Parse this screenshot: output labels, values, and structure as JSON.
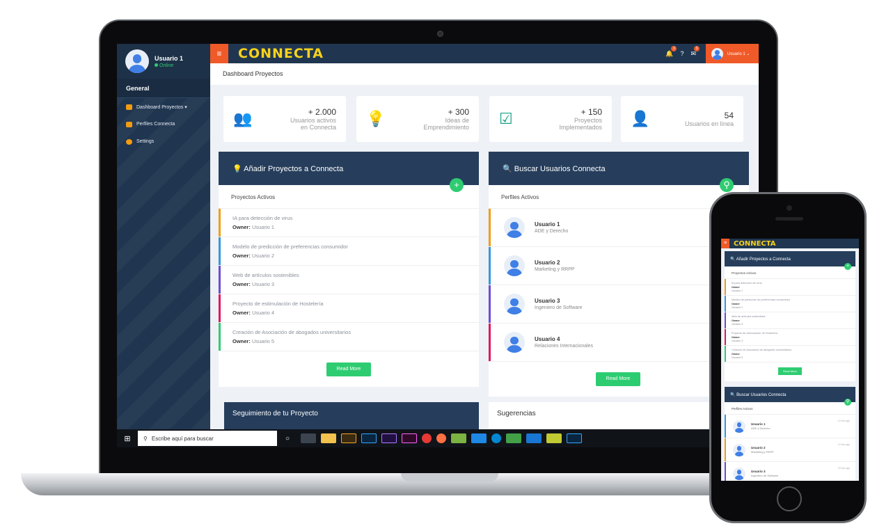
{
  "app": {
    "brand": "CONNECTA",
    "breadcrumb": "Dashboard Proyectos"
  },
  "sidebar": {
    "user": {
      "name": "Usuario 1",
      "status": "Online"
    },
    "section": "General",
    "items": [
      {
        "label": "Dashboard Proyectos ▾",
        "icon": "dashboard-icon"
      },
      {
        "label": "Perfiles Connecta",
        "icon": "users-icon"
      },
      {
        "label": "Settings",
        "icon": "gear-icon"
      }
    ]
  },
  "topbar": {
    "menu_glyph": "≡",
    "notifications": {
      "glyph": "🔔",
      "count": "3"
    },
    "help_glyph": "?",
    "messages": {
      "glyph": "✉",
      "count": "3"
    },
    "user_label": "Usuario 1 ⌄"
  },
  "stats": [
    {
      "value": "+ 2.000",
      "label1": "Usuarios activos",
      "label2": "en Connecta",
      "icon": "users-icon",
      "color": "#f39c12",
      "glyph": "👥"
    },
    {
      "value": "+ 300",
      "label1": "Ideas de",
      "label2": "Emprendimiento",
      "icon": "lightbulb-icon",
      "color": "#f39c12",
      "glyph": "💡"
    },
    {
      "value": "+ 150",
      "label1": "Proyectos",
      "label2": "Implementados",
      "icon": "check-square-icon",
      "color": "#16a085",
      "glyph": "☑"
    },
    {
      "value": "54",
      "label1": "Usuarios en línea",
      "label2": "",
      "icon": "user-plus-icon",
      "color": "#16a085",
      "glyph": "👤"
    }
  ],
  "projects_panel": {
    "title": "💡 Añadir Proyectos a Connecta",
    "fab": "+",
    "subtitle": "Proyectos Activos",
    "owner_label": "Owner:",
    "items": [
      {
        "title": "IA para detección de virus",
        "owner": "Usuario 1"
      },
      {
        "title": "Modelo de predicción de preferencias consumidor",
        "owner": "Usuario 2"
      },
      {
        "title": "Web de artículos sostenibles",
        "owner": "Usuario 3"
      },
      {
        "title": "Proyecto de estimulación de Hostelería",
        "owner": "Usuario 4"
      },
      {
        "title": "Creación de Asociación de abogados universitarios",
        "owner": "Usuario 5"
      }
    ],
    "button": "Read More"
  },
  "users_panel": {
    "title": "🔍 Buscar Usuarios Connecta",
    "fab": "⚲",
    "subtitle": "Perfiles Activos",
    "items": [
      {
        "name": "Usuario 1",
        "role": "ADE y Derecho"
      },
      {
        "name": "Usuario 2",
        "role": "Marketing y RRPP"
      },
      {
        "name": "Usuario 3",
        "role": "Ingeniero de Software"
      },
      {
        "name": "Usuario 4",
        "role": "Relaciones Internacionales"
      }
    ],
    "button": "Read More"
  },
  "tracking_panel": {
    "title": "Seguimiento de tu Proyecto"
  },
  "suggestions_panel": {
    "title": "Sugerencias"
  },
  "taskbar": {
    "start_glyph": "⊞",
    "search_glyph": "⚲",
    "search_placeholder": "Escribe aquí para buscar",
    "task_view_glyph": "○"
  },
  "phone": {
    "menu_glyph": "≡",
    "projects_title": "🔍 Añadir Proyectos a Connecta",
    "projects_fab": "+",
    "projects_subtitle": "Proyectos Activos",
    "owner_label": "Owner",
    "projects": [
      {
        "title": "IA para detección de virus",
        "owner": "Usuario 1"
      },
      {
        "title": "Modelo de predicción de preferencias consumidor",
        "owner": "Usuario 2"
      },
      {
        "title": "Web de artículos sostenibles",
        "owner": "Usuario 3"
      },
      {
        "title": "Proyecto de estimulación de Hostelería",
        "owner": "Usuario 4"
      },
      {
        "title": "Creación de Asociación de abogados universitarios",
        "owner": "Usuario 5"
      }
    ],
    "button": "Read More",
    "users_title": "🔍 Buscar Usuarios Connecta",
    "users_fab": "⚲",
    "users_subtitle": "Perfiles Activos",
    "users": [
      {
        "name": "Usuario 1",
        "role": "ADE y Derecho",
        "ago": "12 min ago"
      },
      {
        "name": "Usuario 2",
        "role": "Marketing y RRPP",
        "ago": "12 min ago"
      },
      {
        "name": "Usuario 3",
        "role": "Ingeniero de Software",
        "ago": "12 min ago"
      }
    ]
  },
  "colors": {
    "accent": "#f05a28",
    "navy": "#203650",
    "green": "#2ecc71",
    "logo": "#f7d21c"
  }
}
